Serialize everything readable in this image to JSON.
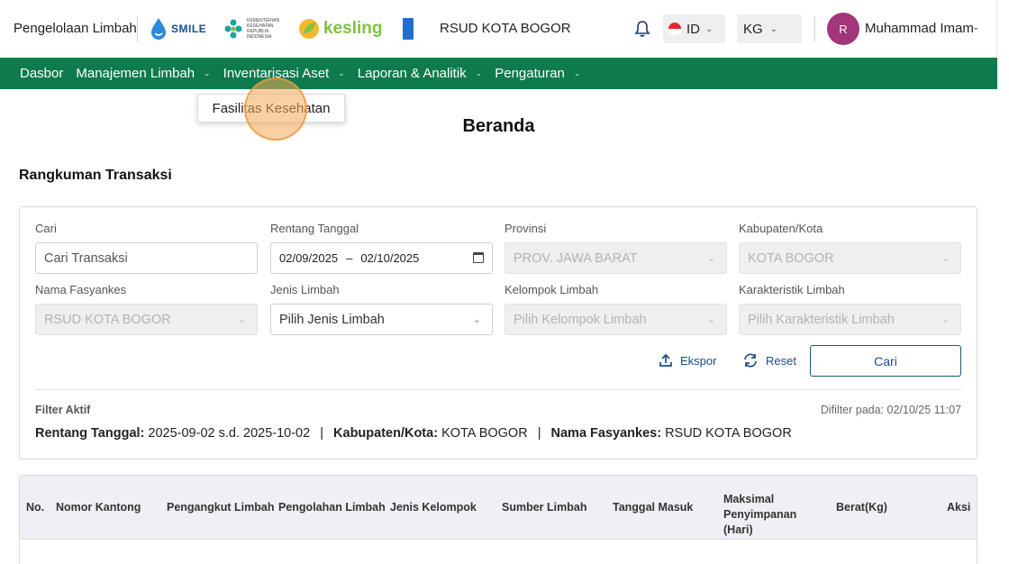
{
  "header": {
    "app_title": "Pengelolaan Limbah",
    "logos": {
      "smile": "SMILE",
      "kemenkes": "KEMENTERIAN KESEHATAN REPUBLIK INDONESIA",
      "kesling": "kesling",
      "undp": "UNDP"
    },
    "hospital": "RSUD KOTA BOGOR",
    "notification_icon": "bell-icon",
    "language": "ID",
    "unit": "KG",
    "user": {
      "initial": "R",
      "name": "Muhammad Imam"
    }
  },
  "nav": {
    "items": [
      {
        "label": "Dasbor",
        "has_dropdown": false
      },
      {
        "label": "Manajemen Limbah",
        "has_dropdown": true
      },
      {
        "label": "Inventarisasi Aset",
        "has_dropdown": true
      },
      {
        "label": "Laporan & Analitik",
        "has_dropdown": true
      },
      {
        "label": "Pengaturan",
        "has_dropdown": true
      }
    ],
    "open_dropdown": {
      "item": "Fasilitas Kesehatan"
    }
  },
  "page": {
    "title": "Beranda",
    "section_title": "Rangkuman Transaksi"
  },
  "filters": {
    "search": {
      "label": "Cari",
      "placeholder": "Cari Transaksi"
    },
    "date_range": {
      "label": "Rentang Tanggal",
      "start": "02/09/2025",
      "separator": "–",
      "end": "02/10/2025"
    },
    "province": {
      "label": "Provinsi",
      "value": "PROV. JAWA BARAT"
    },
    "city": {
      "label": "Kabupaten/Kota",
      "value": "KOTA BOGOR"
    },
    "facility": {
      "label": "Nama Fasyankes",
      "value": "RSUD KOTA BOGOR"
    },
    "waste_type": {
      "label": "Jenis Limbah",
      "placeholder": "Pilih Jenis Limbah"
    },
    "waste_group": {
      "label": "Kelompok Limbah",
      "placeholder": "Pilih Kelompok Limbah"
    },
    "waste_characteristic": {
      "label": "Karakteristik Limbah",
      "placeholder": "Pilih Karakteristik Limbah"
    },
    "export_label": "Ekspor",
    "reset_label": "Reset",
    "search_button": "Cari"
  },
  "active_filter": {
    "title": "Filter Aktif",
    "timestamp": "Difilter pada: 02/10/25 11:07",
    "date_key": "Rentang Tanggal:",
    "date_value": "2025-09-02 s.d. 2025-10-02",
    "city_key": "Kabupaten/Kota:",
    "city_value": "KOTA BOGOR",
    "facility_key": "Nama Fasyankes:",
    "facility_value": "RSUD KOTA BOGOR",
    "separator": "|"
  },
  "table": {
    "columns": [
      "No.",
      "Nomor Kantong",
      "Pengangkut Limbah",
      "Pengolahan Limbah",
      "Jenis Kelompok",
      "Sumber Limbah",
      "Tanggal Masuk",
      "Maksimal Penyimpanan (Hari)",
      "Berat(Kg)",
      "Aksi"
    ]
  },
  "colors": {
    "nav_green": "#0e7a4d",
    "avatar": "#a2357b",
    "link_blue": "#1b4b8a"
  }
}
